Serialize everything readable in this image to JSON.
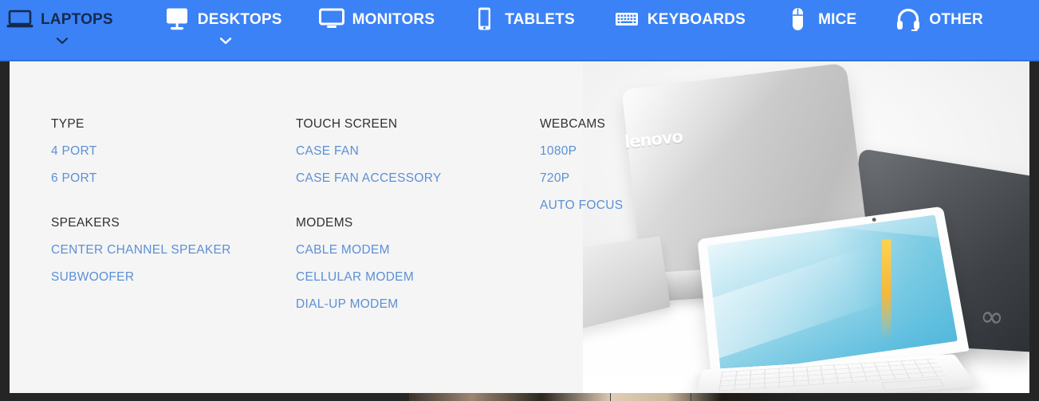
{
  "nav": {
    "background_color": "#3b82f6",
    "active_text_color": "#152a4d",
    "text_color": "#ffffff",
    "items": [
      {
        "label": "LAPTOPS",
        "icon": "laptop-icon",
        "active": true,
        "has_caret": true
      },
      {
        "label": "DESKTOPS",
        "icon": "desktop-icon",
        "active": false,
        "has_caret": true
      },
      {
        "label": "MONITORS",
        "icon": "monitor-icon",
        "active": false,
        "has_caret": false
      },
      {
        "label": "TABLETS",
        "icon": "tablet-icon",
        "active": false,
        "has_caret": false
      },
      {
        "label": "KEYBOARDS",
        "icon": "keyboard-icon",
        "active": false,
        "has_caret": false
      },
      {
        "label": "MICE",
        "icon": "mouse-icon",
        "active": false,
        "has_caret": false
      },
      {
        "label": "OTHER",
        "icon": "headset-icon",
        "active": false,
        "has_caret": false
      }
    ]
  },
  "dropdown": {
    "background_color": "#f5f5f5",
    "link_color": "#5b90d6",
    "heading_color": "#303030",
    "columns": [
      {
        "groups": [
          {
            "title": "TYPE",
            "links": [
              "4 PORT",
              "6 PORT"
            ]
          },
          {
            "title": "SPEAKERS",
            "links": [
              "CENTER CHANNEL SPEAKER",
              "SUBWOOFER"
            ]
          }
        ]
      },
      {
        "groups": [
          {
            "title": "TOUCH SCREEN",
            "links": [
              "CASE FAN",
              "CASE FAN ACCESSORY"
            ]
          },
          {
            "title": "MODEMS",
            "links": [
              "CABLE MODEM",
              "CELLULAR MODEM",
              "DIAL-UP MODEM"
            ]
          }
        ]
      },
      {
        "groups": [
          {
            "title": "WEBCAMS",
            "links": [
              "1080P",
              "720P",
              "AUTO FOCUS"
            ]
          }
        ]
      }
    ]
  },
  "promo": {
    "image_name": "laptops-product-photo",
    "brand_marks": {
      "lenovo": "lenovo",
      "fujitsu": "∞"
    }
  }
}
